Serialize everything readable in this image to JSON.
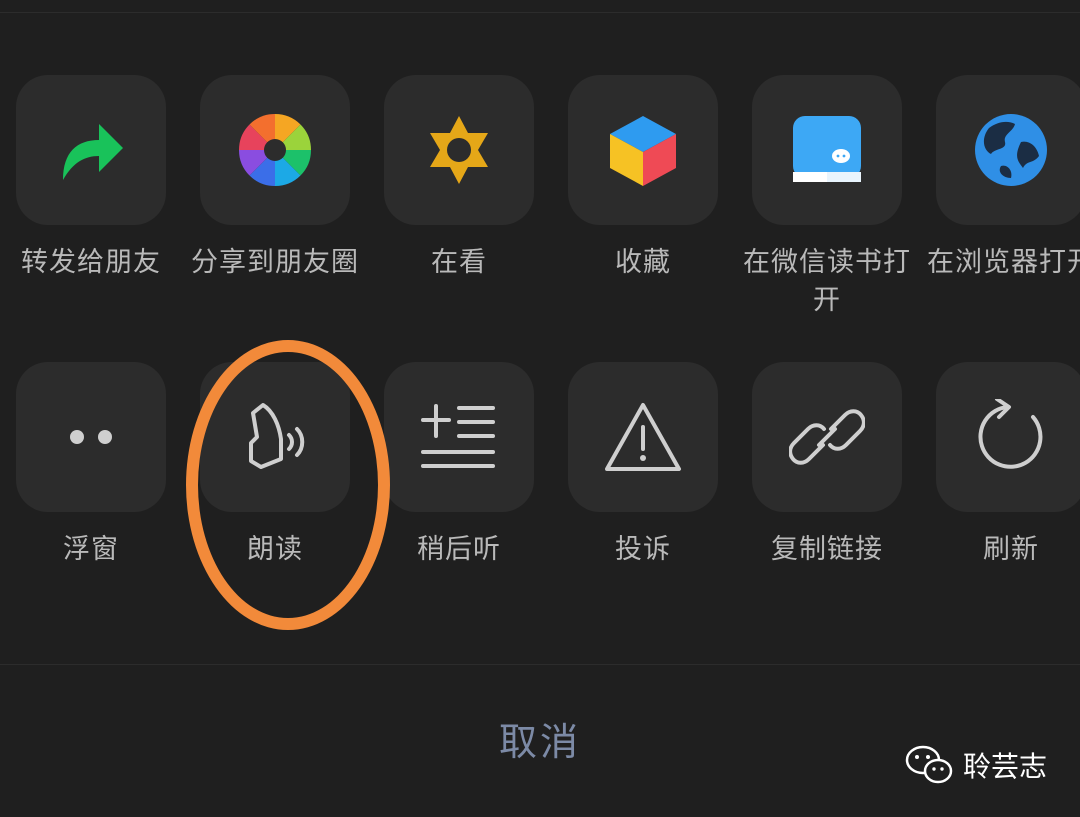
{
  "share_row": [
    {
      "label": "转发给朋友",
      "icon": "forward-arrow-icon",
      "color": "#19c25a"
    },
    {
      "label": "分享到朋友圈",
      "icon": "moments-aperture-icon",
      "color": "#f3b229"
    },
    {
      "label": "在看",
      "icon": "wow-star-icon",
      "color": "#e5a718"
    },
    {
      "label": "收藏",
      "icon": "favorites-cube-icon",
      "color": "#2e9bf0"
    },
    {
      "label": "在微信读书打开",
      "icon": "weread-book-icon",
      "color": "#3da8f5"
    },
    {
      "label": "在浏览器打开",
      "icon": "browser-globe-icon",
      "color": "#2f8fe6"
    }
  ],
  "action_row": [
    {
      "label": "浮窗",
      "icon": "floating-window-icon"
    },
    {
      "label": "朗读",
      "icon": "read-aloud-icon"
    },
    {
      "label": "稍后听",
      "icon": "listen-later-icon"
    },
    {
      "label": "投诉",
      "icon": "complaint-warning-icon"
    },
    {
      "label": "复制链接",
      "icon": "copy-link-icon"
    },
    {
      "label": "刷新",
      "icon": "refresh-icon"
    }
  ],
  "cancel_label": "取消",
  "annotation_color": "#f28a3a",
  "watermark": {
    "text": "聆芸志",
    "icon": "wechat-logo-icon"
  }
}
